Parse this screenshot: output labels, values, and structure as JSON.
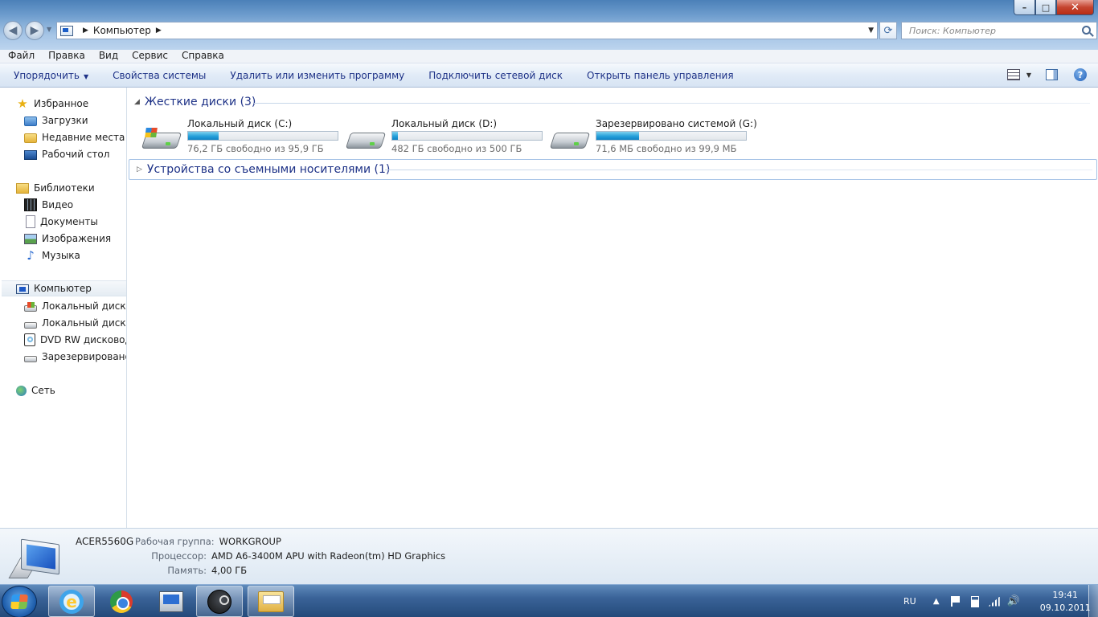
{
  "window": {
    "address_crumb": "Компьютер",
    "search_placeholder": "Поиск: Компьютер",
    "min_glyph": "–",
    "max_glyph": "□",
    "close_glyph": "✕"
  },
  "menu": [
    "Файл",
    "Правка",
    "Вид",
    "Сервис",
    "Справка"
  ],
  "commands": {
    "organize": "Упорядочить",
    "system_props": "Свойства системы",
    "uninstall": "Удалить или изменить программу",
    "map_drive": "Подключить сетевой диск",
    "control_panel": "Открыть панель управления"
  },
  "sidebar": {
    "favorites": {
      "label": "Избранное",
      "icon": "star-icon",
      "items": [
        "Загрузки",
        "Недавние места",
        "Рабочий стол"
      ]
    },
    "libraries": {
      "label": "Библиотеки",
      "icon": "library-icon",
      "items": [
        "Видео",
        "Документы",
        "Изображения",
        "Музыка"
      ]
    },
    "computer": {
      "label": "Компьютер",
      "icon": "computer-icon",
      "items": [
        "Локальный диск (C",
        "Локальный диск (D",
        "DVD RW дисковод (",
        "Зарезервировано с"
      ]
    },
    "network": {
      "label": "Сеть",
      "icon": "network-icon"
    }
  },
  "content": {
    "hard_disks_header": "Жесткие диски (3)",
    "removable_header": "Устройства со съемными носителями (1)",
    "drives": [
      {
        "name": "Локальный диск (C:)",
        "free": "76,2 ГБ свободно из 95,9 ГБ",
        "used_fraction": 0.205,
        "icon": "windows-drive-icon"
      },
      {
        "name": "Локальный диск (D:)",
        "free": "482 ГБ свободно из 500 ГБ",
        "used_fraction": 0.036,
        "icon": "hard-drive-icon"
      },
      {
        "name": "Зарезервировано системой (G:)",
        "free": "71,6 МБ свободно из 99,9 МБ",
        "used_fraction": 0.283,
        "icon": "hard-drive-icon"
      }
    ]
  },
  "details": {
    "computer_name": "ACER5560G",
    "workgroup_label": "Рабочая группа:",
    "workgroup": "WORKGROUP",
    "cpu_label": "Процессор:",
    "cpu": "AMD A6-3400M APU with Radeon(tm) HD Graphics",
    "memory_label": "Память:",
    "memory": "4,00 ГБ"
  },
  "taskbar": {
    "apps": [
      "internet-explorer-icon",
      "chrome-icon",
      "computer-management-icon",
      "steam-icon",
      "windows-explorer-icon"
    ],
    "lang": "RU",
    "time": "19:41",
    "date": "09.10.2011"
  },
  "colors": {
    "link_blue": "#1e3287",
    "progress_blue": "#26a0da",
    "taskbar": "#3a6398"
  }
}
